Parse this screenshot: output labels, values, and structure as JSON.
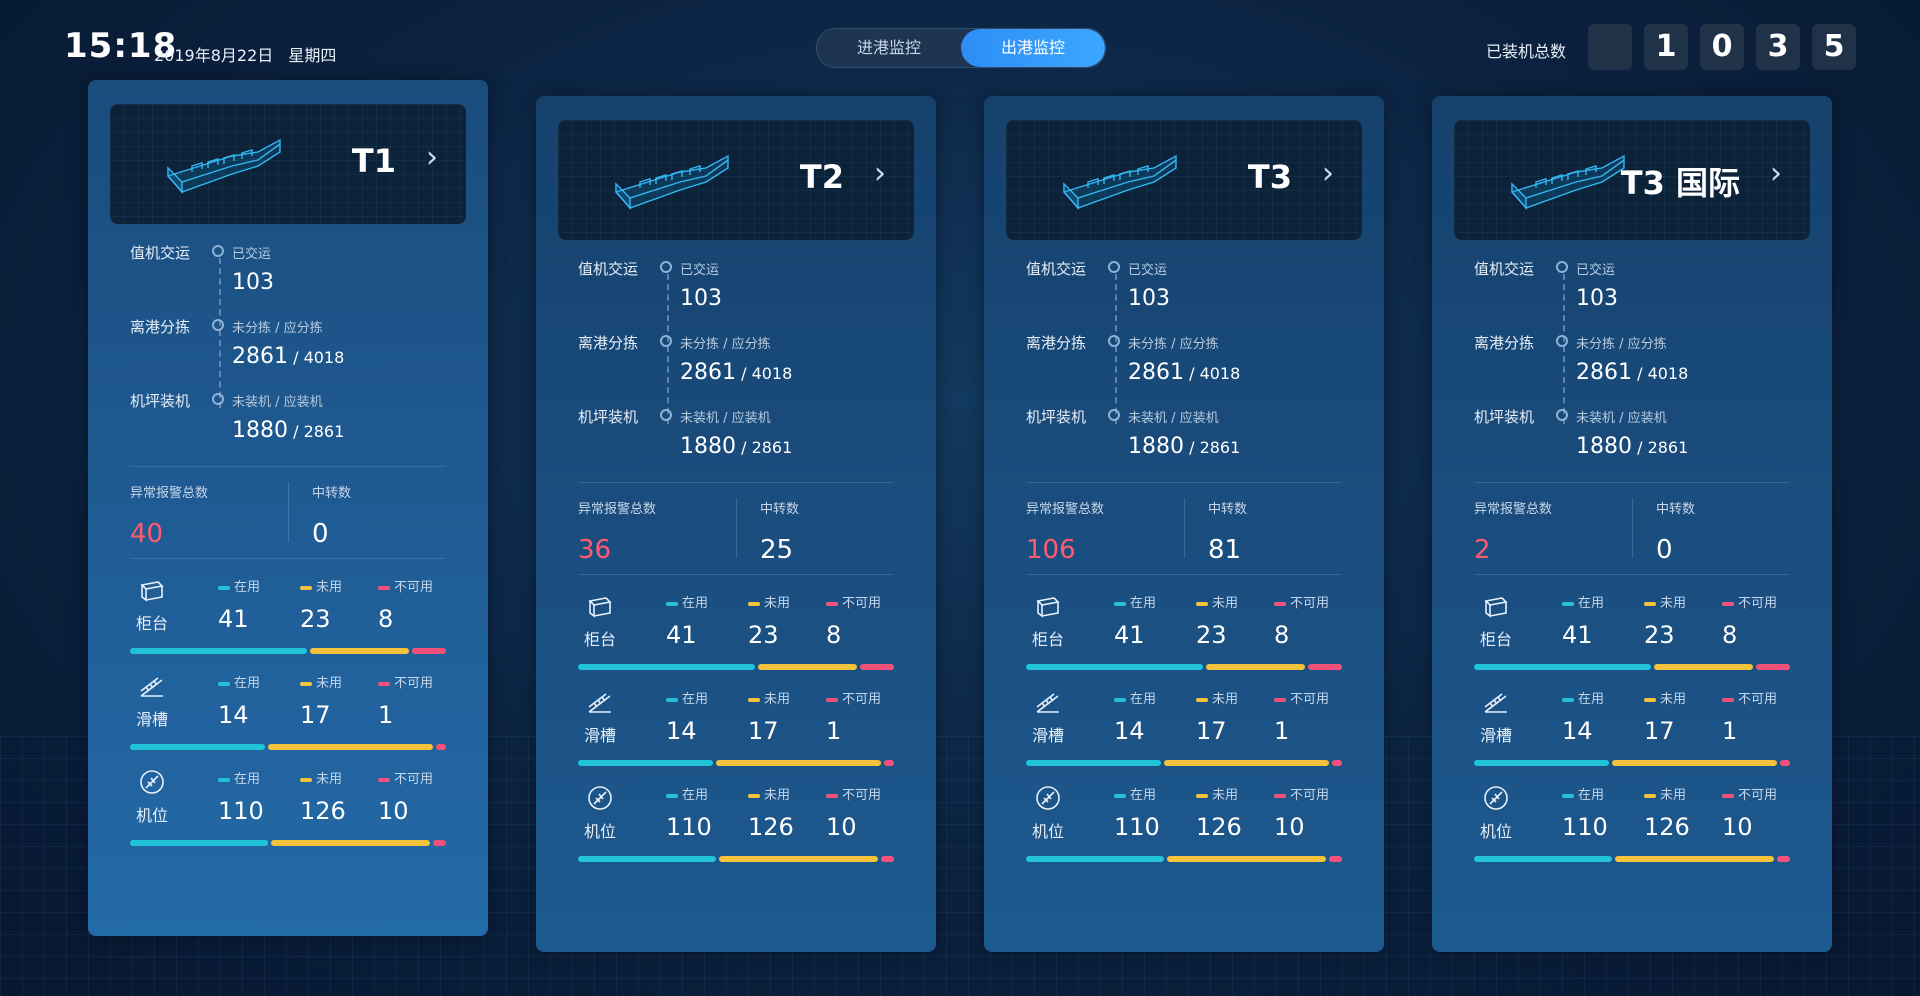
{
  "header": {
    "time": "15:18",
    "date": "2019年8月22日",
    "weekday": "星期四",
    "tabs": [
      {
        "label": "进港监控",
        "active": false
      },
      {
        "label": "出港监控",
        "active": true
      }
    ],
    "total_label": "已装机总数",
    "total_digits": [
      "",
      "1",
      "0",
      "3",
      "5"
    ]
  },
  "legend": {
    "in_use": "在用",
    "unused": "未用",
    "unavailable": "不可用"
  },
  "colors": {
    "in_use": "#22c3d7",
    "unused": "#f4c23b",
    "unavailable": "#f3517a",
    "alarm": "#ff5b6e",
    "accent": "#2d8df5"
  },
  "terminals": [
    {
      "name": "T1",
      "flow": [
        {
          "label": "值机交运",
          "sub": "已交运",
          "value": "103",
          "total": ""
        },
        {
          "label": "离港分拣",
          "sub": "未分拣 / 应分拣",
          "value": "2861",
          "total": "4018"
        },
        {
          "label": "机坪装机",
          "sub": "未装机 / 应装机",
          "value": "1880",
          "total": "2861"
        }
      ],
      "alarm": {
        "label": "异常报警总数",
        "value": "40"
      },
      "transfer": {
        "label": "中转数",
        "value": "0"
      },
      "resources": [
        {
          "name": "柜台",
          "icon": "counter-icon",
          "in_use": "41",
          "unused": "23",
          "unavailable": "8"
        },
        {
          "name": "滑槽",
          "icon": "chute-icon",
          "in_use": "14",
          "unused": "17",
          "unavailable": "1"
        },
        {
          "name": "机位",
          "icon": "stand-icon",
          "in_use": "110",
          "unused": "126",
          "unavailable": "10"
        }
      ]
    },
    {
      "name": "T2",
      "flow": [
        {
          "label": "值机交运",
          "sub": "已交运",
          "value": "103",
          "total": ""
        },
        {
          "label": "离港分拣",
          "sub": "未分拣 / 应分拣",
          "value": "2861",
          "total": "4018"
        },
        {
          "label": "机坪装机",
          "sub": "未装机 / 应装机",
          "value": "1880",
          "total": "2861"
        }
      ],
      "alarm": {
        "label": "异常报警总数",
        "value": "36"
      },
      "transfer": {
        "label": "中转数",
        "value": "25"
      },
      "resources": [
        {
          "name": "柜台",
          "icon": "counter-icon",
          "in_use": "41",
          "unused": "23",
          "unavailable": "8"
        },
        {
          "name": "滑槽",
          "icon": "chute-icon",
          "in_use": "14",
          "unused": "17",
          "unavailable": "1"
        },
        {
          "name": "机位",
          "icon": "stand-icon",
          "in_use": "110",
          "unused": "126",
          "unavailable": "10"
        }
      ]
    },
    {
      "name": "T3",
      "flow": [
        {
          "label": "值机交运",
          "sub": "已交运",
          "value": "103",
          "total": ""
        },
        {
          "label": "离港分拣",
          "sub": "未分拣 / 应分拣",
          "value": "2861",
          "total": "4018"
        },
        {
          "label": "机坪装机",
          "sub": "未装机 / 应装机",
          "value": "1880",
          "total": "2861"
        }
      ],
      "alarm": {
        "label": "异常报警总数",
        "value": "106"
      },
      "transfer": {
        "label": "中转数",
        "value": "81"
      },
      "resources": [
        {
          "name": "柜台",
          "icon": "counter-icon",
          "in_use": "41",
          "unused": "23",
          "unavailable": "8"
        },
        {
          "name": "滑槽",
          "icon": "chute-icon",
          "in_use": "14",
          "unused": "17",
          "unavailable": "1"
        },
        {
          "name": "机位",
          "icon": "stand-icon",
          "in_use": "110",
          "unused": "126",
          "unavailable": "10"
        }
      ]
    },
    {
      "name": "T3 国际",
      "flow": [
        {
          "label": "值机交运",
          "sub": "已交运",
          "value": "103",
          "total": ""
        },
        {
          "label": "离港分拣",
          "sub": "未分拣 / 应分拣",
          "value": "2861",
          "total": "4018"
        },
        {
          "label": "机坪装机",
          "sub": "未装机 / 应装机",
          "value": "1880",
          "total": "2861"
        }
      ],
      "alarm": {
        "label": "异常报警总数",
        "value": "2"
      },
      "transfer": {
        "label": "中转数",
        "value": "0"
      },
      "resources": [
        {
          "name": "柜台",
          "icon": "counter-icon",
          "in_use": "41",
          "unused": "23",
          "unavailable": "8"
        },
        {
          "name": "滑槽",
          "icon": "chute-icon",
          "in_use": "14",
          "unused": "17",
          "unavailable": "1"
        },
        {
          "name": "机位",
          "icon": "stand-icon",
          "in_use": "110",
          "unused": "126",
          "unavailable": "10"
        }
      ]
    }
  ]
}
